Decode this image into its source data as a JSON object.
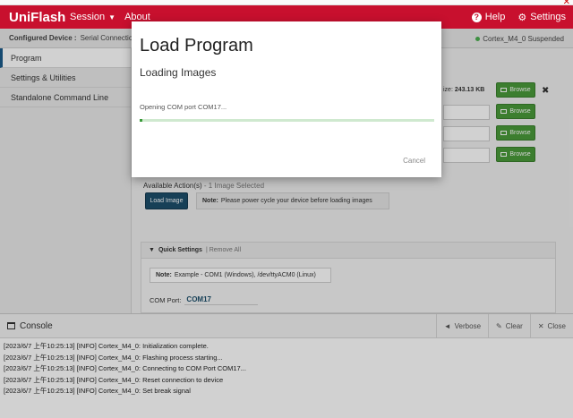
{
  "header": {
    "brand": "UniFlash",
    "nav": [
      {
        "label": "Session"
      },
      {
        "label": "About"
      }
    ],
    "help_label": "Help",
    "settings_label": "Settings"
  },
  "breadcrumb": {
    "label": "Configured Device :",
    "value": "Serial Connection",
    "device_status": "Cortex_M4_0 Suspended",
    "status_color": "#4caf50"
  },
  "sidebar": {
    "items": [
      {
        "label": "Program",
        "active": true
      },
      {
        "label": "Settings & Utilities",
        "active": false
      },
      {
        "label": "Standalone Command Line",
        "active": false
      }
    ]
  },
  "main": {
    "size_label": "ize:",
    "size_value": "243.13 KB",
    "browse_label": "Browse",
    "remove_glyph": "✖",
    "actions_title": "Available Action(s)",
    "actions_sub": "- 1 Image Selected",
    "load_image_label": "Load Image",
    "note_label": "Note:",
    "note_text": "Please power cycle your device before loading images",
    "quick_settings": {
      "title": "Quick Settings",
      "remove_all": "| Remove All",
      "note_label": "Note:",
      "note_text": "Example - COM1 (Windows), /dev/ttyACM0 (Linux)",
      "com_port_label": "COM Port:",
      "com_port_value": "COM17"
    }
  },
  "console": {
    "title": "Console",
    "tools": [
      {
        "label": "Verbose",
        "icon": "megaphone-icon"
      },
      {
        "label": "Clear",
        "icon": "eraser-icon"
      },
      {
        "label": "Close",
        "icon": "close-icon"
      }
    ],
    "lines": [
      "[2023/6/7 上午10:25:13] [INFO] Cortex_M4_0: Initialization complete.",
      "[2023/6/7 上午10:25:13] [INFO] Cortex_M4_0: Flashing process starting...",
      "[2023/6/7 上午10:25:13] [INFO] Cortex_M4_0: Connecting to COM Port COM17...",
      "[2023/6/7 上午10:25:13] [INFO] Cortex_M4_0: Reset connection to device",
      "[2023/6/7 上午10:25:13] [INFO] Cortex_M4_0: Set break signal"
    ]
  },
  "modal": {
    "title": "Load Program",
    "subtitle": "Loading Images",
    "status": "Opening COM port COM17...",
    "progress": 0.01,
    "cancel_label": "Cancel",
    "accent_color": "#3a9a3a"
  }
}
